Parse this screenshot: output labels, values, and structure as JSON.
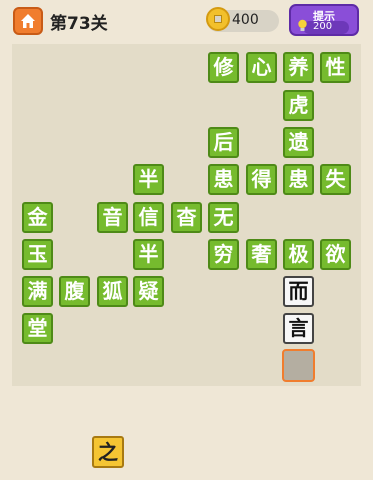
{
  "header": {
    "level_title": "第73关",
    "coins": "400",
    "hint_label": "提示",
    "hint_cost": "200"
  },
  "grid": {
    "r0c5": "修",
    "r0c6": "心",
    "r0c7": "养",
    "r0c8": "性",
    "r1c7": "虎",
    "r2c5": "后",
    "r2c7": "遗",
    "r3c3": "半",
    "r3c5": "患",
    "r3c6": "得",
    "r3c7": "患",
    "r3c8": "失",
    "r4c0": "金",
    "r4c2": "音",
    "r4c3": "信",
    "r4c4": "杳",
    "r4c5": "无",
    "r5c0": "玉",
    "r5c3": "半",
    "r5c5": "穷",
    "r5c6": "奢",
    "r5c7": "极",
    "r5c8": "欲",
    "r6c0": "满",
    "r6c1": "腹",
    "r6c2": "狐",
    "r6c3": "疑",
    "r6c7": "而",
    "r7c0": "堂",
    "r7c7": "言"
  },
  "choices": [
    "之"
  ]
}
